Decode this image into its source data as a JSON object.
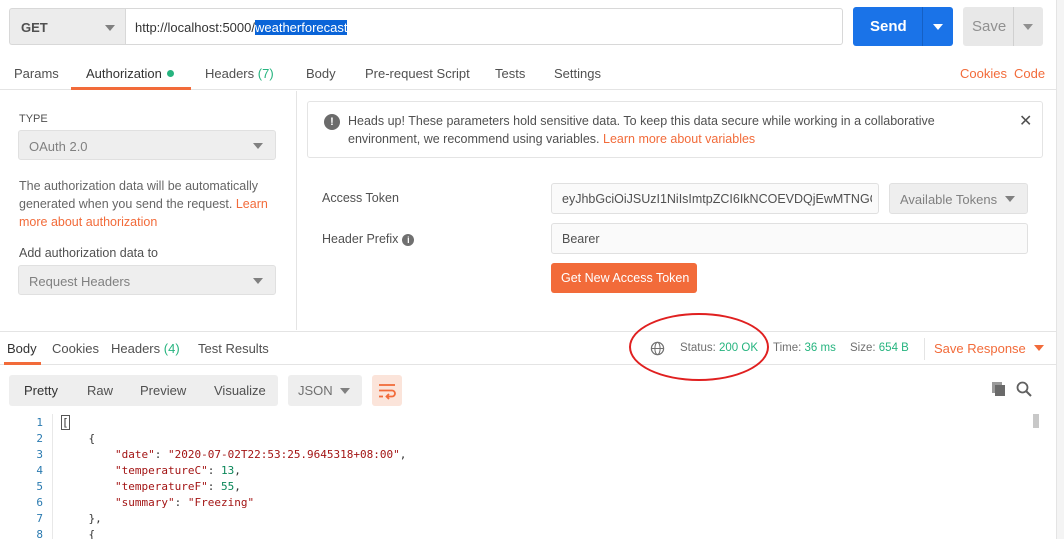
{
  "request": {
    "method": "GET",
    "url_prefix": "http://localhost:5000/",
    "url_selected": "weatherforecast",
    "send_label": "Send",
    "save_label": "Save"
  },
  "req_tabs": {
    "params": "Params",
    "authorization": "Authorization",
    "headers": "Headers",
    "headers_count": "(7)",
    "body": "Body",
    "prerequest": "Pre-request Script",
    "tests": "Tests",
    "settings": "Settings",
    "cookies": "Cookies",
    "code": "Code"
  },
  "auth": {
    "type_label": "TYPE",
    "type_value": "OAuth 2.0",
    "desc": "The authorization data will be automatically generated when you send the request.",
    "desc_link": "Learn more about authorization",
    "add_label": "Add authorization data to",
    "add_value": "Request Headers",
    "notice_text": "Heads up! These parameters hold sensitive data. To keep this data secure while working in a collaborative environment, we recommend using variables.",
    "notice_link": "Learn more about variables",
    "access_token_label": "Access Token",
    "access_token_value": "eyJhbGciOiJSUzI1NiIsImtpZCI6IkNCOEVDQjEwMTNGC...",
    "available_tokens": "Available Tokens",
    "header_prefix_label": "Header Prefix",
    "header_prefix_value": "Bearer",
    "get_token_label": "Get New Access Token"
  },
  "response": {
    "tabs": {
      "body": "Body",
      "cookies": "Cookies",
      "headers": "Headers",
      "headers_count": "(4)",
      "test_results": "Test Results"
    },
    "status_label": "Status:",
    "status_value": "200 OK",
    "time_label": "Time:",
    "time_value": "36 ms",
    "size_label": "Size:",
    "size_value": "654 B",
    "save_response": "Save Response",
    "views": {
      "pretty": "Pretty",
      "raw": "Raw",
      "preview": "Preview",
      "visualize": "Visualize"
    },
    "format": "JSON"
  },
  "code_lines": [
    {
      "n": "1",
      "text": "["
    },
    {
      "n": "2",
      "text": "    {"
    },
    {
      "n": "3",
      "key": "\"date\"",
      "val": "\"2020-07-02T22:53:25.9645318+08:00\"",
      "tail": ","
    },
    {
      "n": "4",
      "key": "\"temperatureC\"",
      "val": "13",
      "tail": ","
    },
    {
      "n": "5",
      "key": "\"temperatureF\"",
      "val": "55",
      "tail": ","
    },
    {
      "n": "6",
      "key": "\"summary\"",
      "val": "\"Freezing\"",
      "tail": ""
    },
    {
      "n": "7",
      "text": "    },"
    },
    {
      "n": "8",
      "text": "    {"
    }
  ],
  "colors": {
    "accent": "#f26b3a",
    "primary": "#1a73e8",
    "success": "#26b47f",
    "annotation": "#e02020"
  }
}
